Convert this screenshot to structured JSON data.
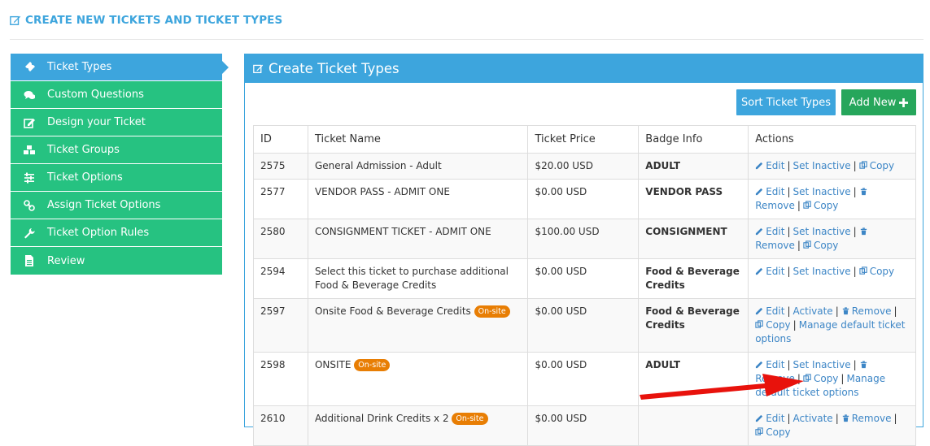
{
  "page": {
    "title": "CREATE NEW TICKETS AND TICKET TYPES"
  },
  "sidebar": {
    "items": [
      {
        "label": "Ticket Types",
        "icon": "ticket-icon",
        "active": true
      },
      {
        "label": "Custom Questions",
        "icon": "comments-icon"
      },
      {
        "label": "Design your Ticket",
        "icon": "edit-icon"
      },
      {
        "label": "Ticket Groups",
        "icon": "cubes-icon"
      },
      {
        "label": "Ticket Options",
        "icon": "sliders-icon"
      },
      {
        "label": "Assign Ticket Options",
        "icon": "link-icon"
      },
      {
        "label": "Ticket Option Rules",
        "icon": "wrench-icon"
      },
      {
        "label": "Review",
        "icon": "file-icon"
      }
    ]
  },
  "panel": {
    "title": "Create Ticket Types",
    "sort_label": "Sort Ticket Types",
    "add_label": "Add New"
  },
  "table": {
    "headers": [
      "ID",
      "Ticket Name",
      "Ticket Price",
      "Badge Info",
      "Actions"
    ],
    "rows": [
      {
        "id": "2575",
        "name": "General Admission - Adult",
        "pill": "",
        "price": "$20.00 USD",
        "badge": "ADULT",
        "actions": [
          "Edit",
          "Set Inactive",
          "Copy"
        ]
      },
      {
        "id": "2577",
        "name": "VENDOR PASS - ADMIT ONE",
        "pill": "",
        "price": "$0.00 USD",
        "badge": "VENDOR PASS",
        "actions": [
          "Edit",
          "Set Inactive",
          "Remove",
          "Copy"
        ]
      },
      {
        "id": "2580",
        "name": "CONSIGNMENT TICKET - ADMIT ONE",
        "pill": "",
        "price": "$100.00 USD",
        "badge": "CONSIGNMENT",
        "actions": [
          "Edit",
          "Set Inactive",
          "Remove",
          "Copy"
        ]
      },
      {
        "id": "2594",
        "name": "Select this ticket to purchase additional Food & Beverage Credits",
        "pill": "",
        "price": "$0.00 USD",
        "badge": "Food & Beverage Credits",
        "actions": [
          "Edit",
          "Set Inactive",
          "Copy"
        ]
      },
      {
        "id": "2597",
        "name": "Onsite Food & Beverage Credits",
        "pill": "On-site",
        "price": "$0.00 USD",
        "badge": "Food & Beverage Credits",
        "actions": [
          "Edit",
          "Activate",
          "Remove",
          "Copy",
          "Manage default ticket options"
        ]
      },
      {
        "id": "2598",
        "name": "ONSITE",
        "pill": "On-site",
        "price": "$0.00 USD",
        "badge": "ADULT",
        "actions": [
          "Edit",
          "Set Inactive",
          "Remove",
          "Copy",
          "Manage default ticket options"
        ]
      },
      {
        "id": "2610",
        "name": "Additional Drink Credits x 2",
        "pill": "On-site",
        "price": "$0.00 USD",
        "badge": "",
        "actions": [
          "Edit",
          "Activate",
          "Remove",
          "Copy"
        ]
      }
    ]
  },
  "colors": {
    "accent": "#3da5dd",
    "sidebar": "#26c281",
    "add": "#26a65b",
    "pill": "#e87e04",
    "link": "#3d86c6",
    "arrow": "#e8120c"
  }
}
